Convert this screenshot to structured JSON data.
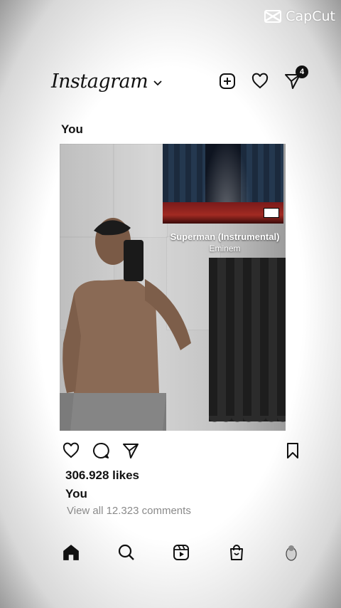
{
  "watermark": {
    "label": "CapCut"
  },
  "header": {
    "logo_text": "Instagram",
    "icons": [
      "create-icon",
      "heart-icon",
      "direct-icon"
    ],
    "messages_badge": "4"
  },
  "post": {
    "username": "You",
    "music": {
      "title": "Superman (Instrumental)",
      "artist": "Eminem"
    },
    "likes": "306.928 likes",
    "caption_user": "You",
    "comments_link": "View all 12.323 comments"
  },
  "nav": {
    "icons": [
      "home-icon",
      "search-icon",
      "reels-icon",
      "shop-icon",
      "profile-icon"
    ]
  },
  "colors": {
    "text": "#111111",
    "muted": "#8a8a8a",
    "badge": "#111111"
  }
}
